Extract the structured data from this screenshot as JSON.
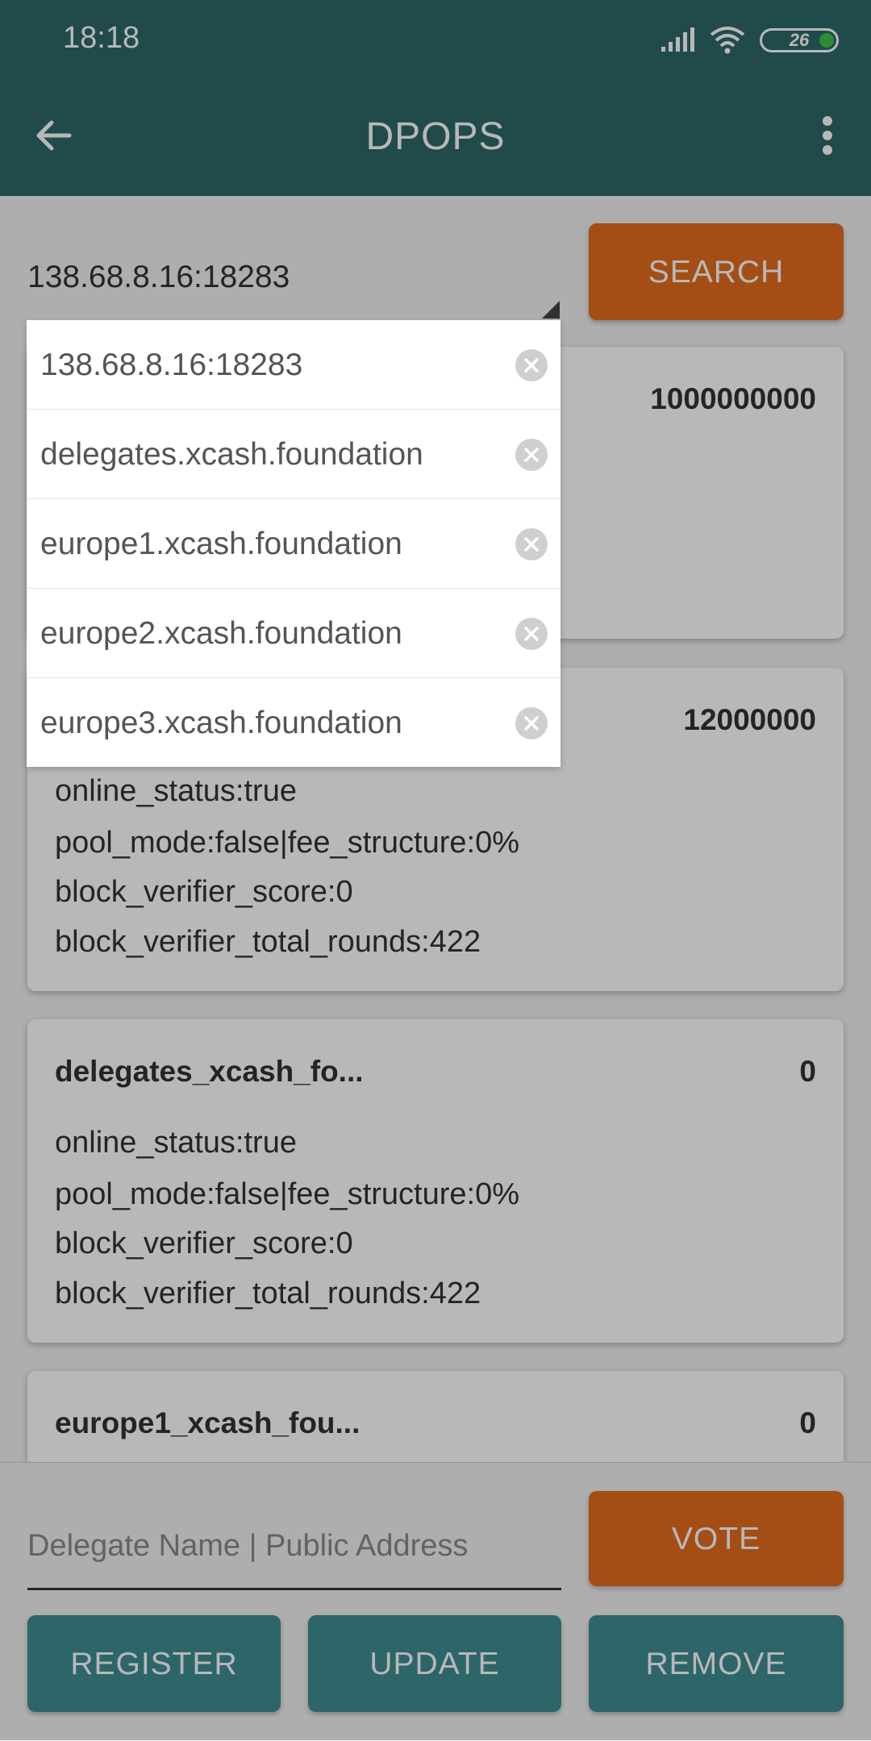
{
  "status_bar": {
    "time": "18:18",
    "battery": "26"
  },
  "toolbar": {
    "title": "DPOPS"
  },
  "search": {
    "node_value": "138.68.8.16:18283",
    "button_label": "SEARCH"
  },
  "delegates": [
    {
      "name": "",
      "votes": "1000000000",
      "lines": []
    },
    {
      "name": "",
      "votes": "12000000",
      "lines": [
        "online_status:true",
        "pool_mode:false|fee_structure:0%",
        "block_verifier_score:0",
        "block_verifier_total_rounds:422"
      ]
    },
    {
      "name": "delegates_xcash_fo...",
      "votes": "0",
      "lines": [
        "online_status:true",
        "pool_mode:false|fee_structure:0%",
        "block_verifier_score:0",
        "block_verifier_total_rounds:422"
      ]
    },
    {
      "name": "europe1_xcash_fou...",
      "votes": "0",
      "lines": []
    }
  ],
  "dropdown": {
    "items": [
      "138.68.8.16:18283",
      "delegates.xcash.foundation",
      "europe1.xcash.foundation",
      "europe2.xcash.foundation",
      "europe3.xcash.foundation"
    ]
  },
  "vote": {
    "placeholder": "Delegate Name | Public Address",
    "button_label": "VOTE"
  },
  "actions": {
    "register_label": "REGISTER",
    "update_label": "UPDATE",
    "remove_label": "REMOVE"
  },
  "colors": {
    "primary": "#2e6768",
    "accent": "#e36c1f",
    "secondary": "#3f8e90"
  }
}
